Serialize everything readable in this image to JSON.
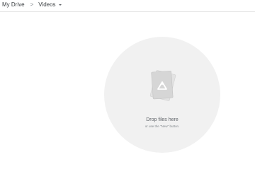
{
  "breadcrumb": {
    "root": "My Drive",
    "separator": ">",
    "current": "Videos"
  },
  "empty_state": {
    "title": "Drop files here",
    "hint": "or use the \"New\" button."
  },
  "icons": {
    "separator": "chevron-right-icon",
    "dropdown": "chevron-down-icon",
    "illustration": "drive-logo-icon"
  }
}
